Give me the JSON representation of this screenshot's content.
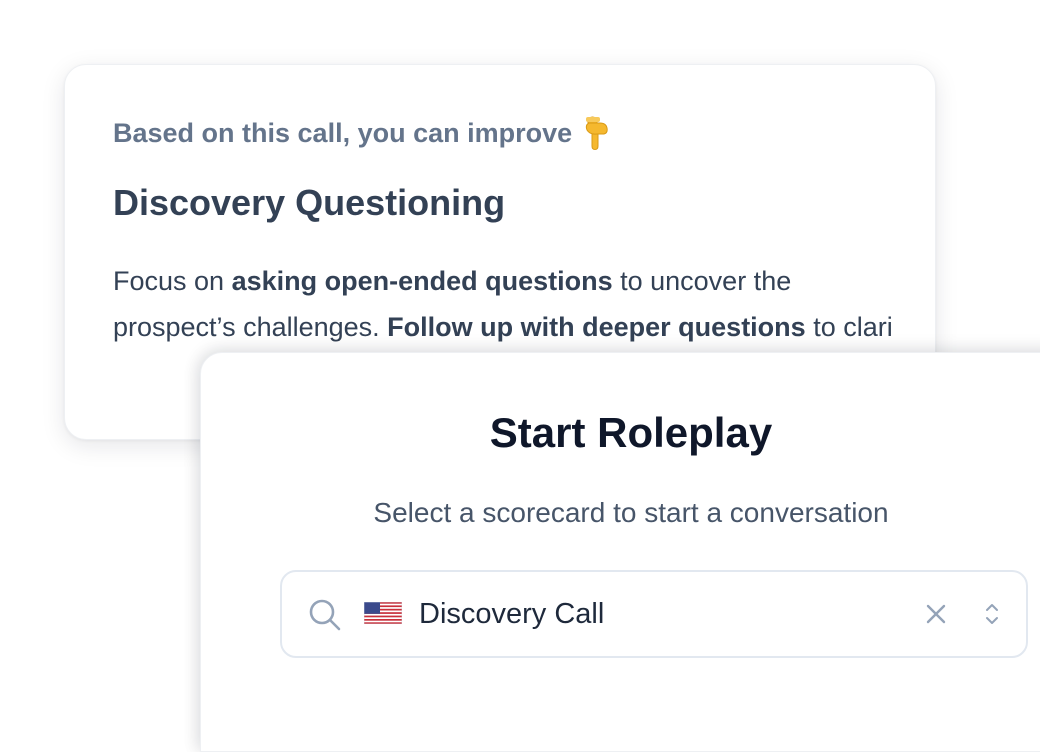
{
  "feedback_card": {
    "eyebrow": "Based on this call, you can improve",
    "eyebrow_icon": "pointing-down-hand-icon",
    "title": "Discovery Questioning",
    "body": {
      "part1": "Focus on ",
      "bold1": "asking open-ended questions",
      "part2": " to uncover the prospect’s challenges. ",
      "bold2": "Follow up with deeper questions",
      "part3": " to clari"
    }
  },
  "roleplay_modal": {
    "title": "Start Roleplay",
    "subtitle": "Select a scorecard to start a conversation",
    "search": {
      "value": "Discovery Call",
      "flag": "us-flag-icon",
      "search_icon": "search-icon",
      "clear_icon": "close-icon",
      "toggle_icon": "chevron-up-down-icon"
    }
  },
  "colors": {
    "heading": "#0f172a",
    "text": "#334155",
    "muted": "#64748b",
    "border": "#e2e8f0"
  }
}
